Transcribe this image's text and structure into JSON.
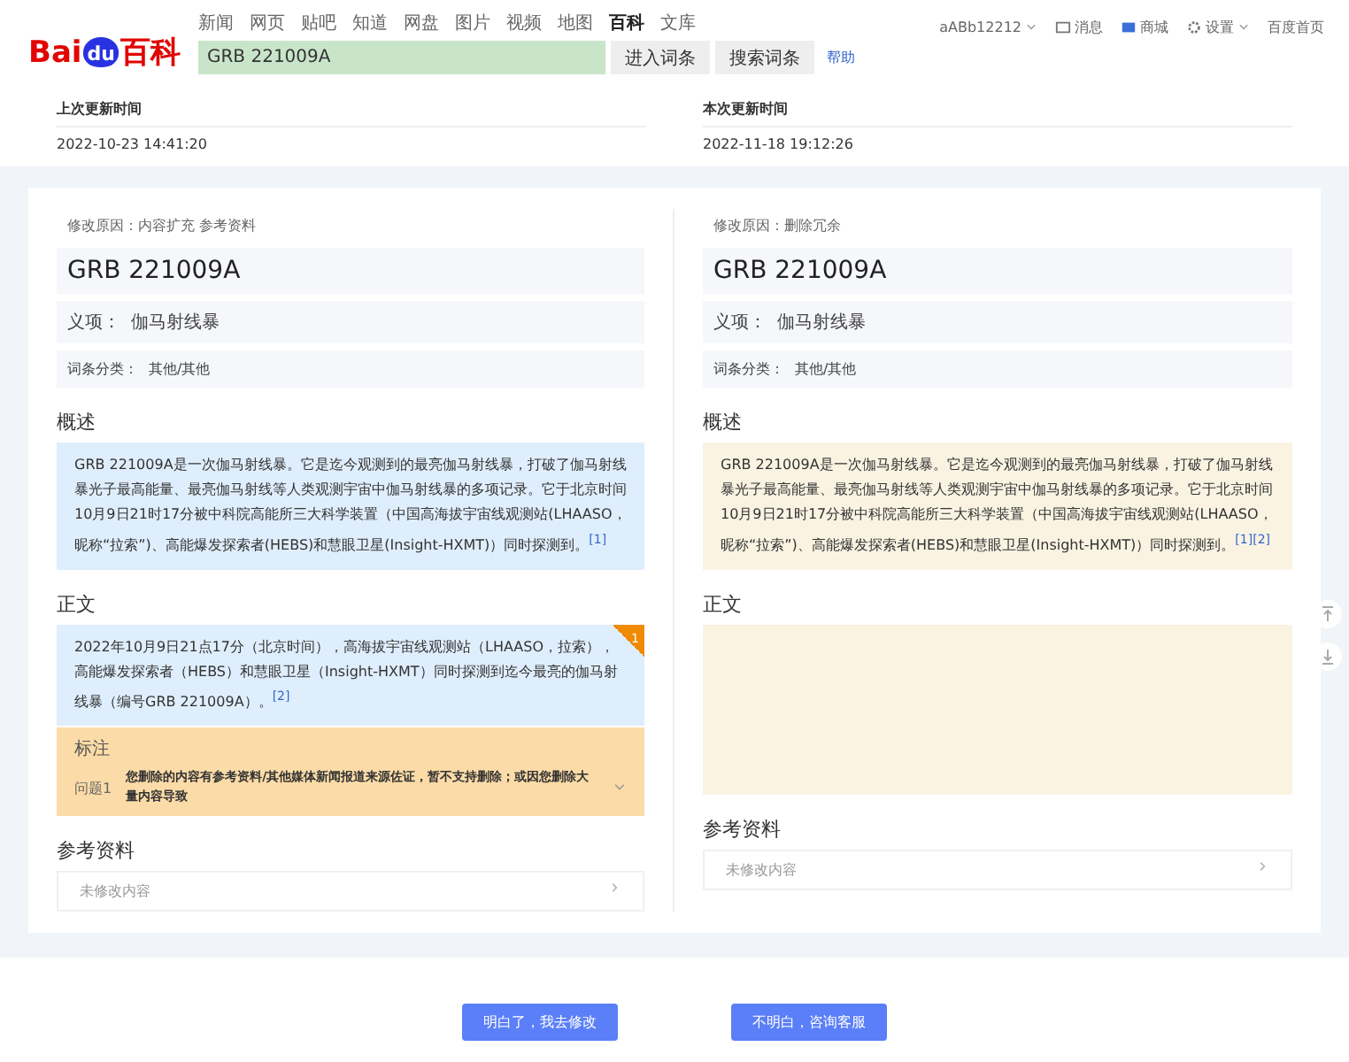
{
  "logo": {
    "left": "Bai",
    "paw": "du",
    "right": "百科"
  },
  "nav": [
    {
      "label": "新闻",
      "selected": false
    },
    {
      "label": "网页",
      "selected": false
    },
    {
      "label": "贴吧",
      "selected": false
    },
    {
      "label": "知道",
      "selected": false
    },
    {
      "label": "网盘",
      "selected": false
    },
    {
      "label": "图片",
      "selected": false
    },
    {
      "label": "视频",
      "selected": false
    },
    {
      "label": "地图",
      "selected": false
    },
    {
      "label": "百科",
      "selected": true
    },
    {
      "label": "文库",
      "selected": false
    }
  ],
  "search": {
    "value": "GRB 221009A",
    "buttons": [
      "进入词条",
      "搜索词条"
    ],
    "help": "帮助"
  },
  "user_menu": [
    {
      "kind": "user",
      "label": "aABb12212"
    },
    {
      "kind": "message",
      "label": "消息"
    },
    {
      "kind": "shop",
      "label": "商城"
    },
    {
      "kind": "settings",
      "label": "设置"
    },
    {
      "kind": "home",
      "label": "百度首页"
    }
  ],
  "times": [
    {
      "label": "上次更新时间",
      "value": "2022-10-23 14:41:20"
    },
    {
      "label": "本次更新时间",
      "value": "2022-11-18 19:12:26"
    }
  ],
  "panels": [
    {
      "kind": "old",
      "reason": "修改原因：内容扩充 参考资料",
      "title": "GRB 221009A",
      "sense_label": "义项：",
      "sense": "伽马射线暴",
      "category_label": "词条分类：",
      "category": "其他/其他",
      "summary_heading": "概述",
      "summary": "GRB 221009A是一次伽马射线暴。它是迄今观测到的最亮伽马射线暴，打破了伽马射线暴光子最高能量、最亮伽马射线等人类观测宇宙中伽马射线暴的多项记录。它于北京时间10月9日21时17分被中科院高能所三大科学装置（中国高海拔宇宙线观测站(LHAASO，昵称“拉索”)、高能爆发探索者(HEBS)和慧眼卫星(Insight-HXMT)）同时探测到。$^{[1]}$",
      "body_heading": "正文",
      "body": "2022年10月9日21点17分（北京时间），高海拔宇宙线观测站（LHAASO，拉索），高能爆发探索者（HEBS）和慧眼卫星（Insight-HXMT）同时探测到迄今最亮的伽马射线暴（编号GRB 221009A）。$^{[2]}$",
      "badge": "1",
      "annotation": {
        "title": "标注",
        "issue_label": "问题1",
        "issue": "您删除的内容有参考资料/其他媒体新闻报道来源佐证，暂不支持删除；或因您删除大量内容导致",
        "expanded": false
      },
      "refs_heading": "参考资料",
      "refs": "未修改内容"
    },
    {
      "kind": "new",
      "reason": "修改原因：删除冗余",
      "title": "GRB 221009A",
      "sense_label": "义项：",
      "sense": "伽马射线暴",
      "category_label": "词条分类：",
      "category": "其他/其他",
      "summary_heading": "概述",
      "summary": "GRB 221009A是一次伽马射线暴。它是迄今观测到的最亮伽马射线暴，打破了伽马射线暴光子最高能量、最亮伽马射线等人类观测宇宙中伽马射线暴的多项记录。它于北京时间10月9日21时17分被中科院高能所三大科学装置（中国高海拔宇宙线观测站(LHAASO，昵称“拉索”)、高能爆发探索者(HEBS)和慧眼卫星(Insight-HXMT)）同时探测到。$^{[1][2]}$",
      "body_heading": "正文",
      "refs_heading": "参考资料",
      "refs": "未修改内容"
    }
  ],
  "actions": [
    "明白了，我去修改",
    "不明白，咨询客服"
  ]
}
